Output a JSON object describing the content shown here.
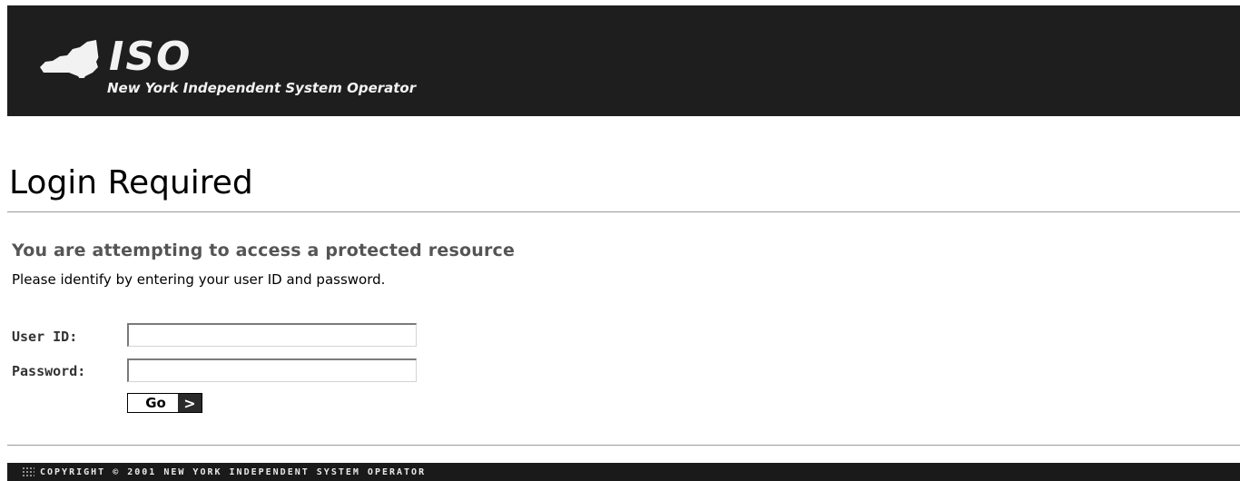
{
  "header": {
    "logo_text": "ISO",
    "org_name": "New York Independent System Operator",
    "colors": {
      "background": "#1e1e1e",
      "logo": "#f2f2f2"
    }
  },
  "main": {
    "title": "Login Required",
    "subheading": "You are attempting to access a protected resource",
    "instruction": "Please identify by entering your user ID and password.",
    "form": {
      "user_label": "User ID:",
      "user_value": "",
      "password_label": "Password:",
      "password_value": "",
      "submit_label": "Go",
      "submit_arrow": ">"
    }
  },
  "footer": {
    "copyright": "COPYRIGHT © 2001 NEW YORK INDEPENDENT SYSTEM OPERATOR",
    "icon": "dots-grid-icon"
  }
}
